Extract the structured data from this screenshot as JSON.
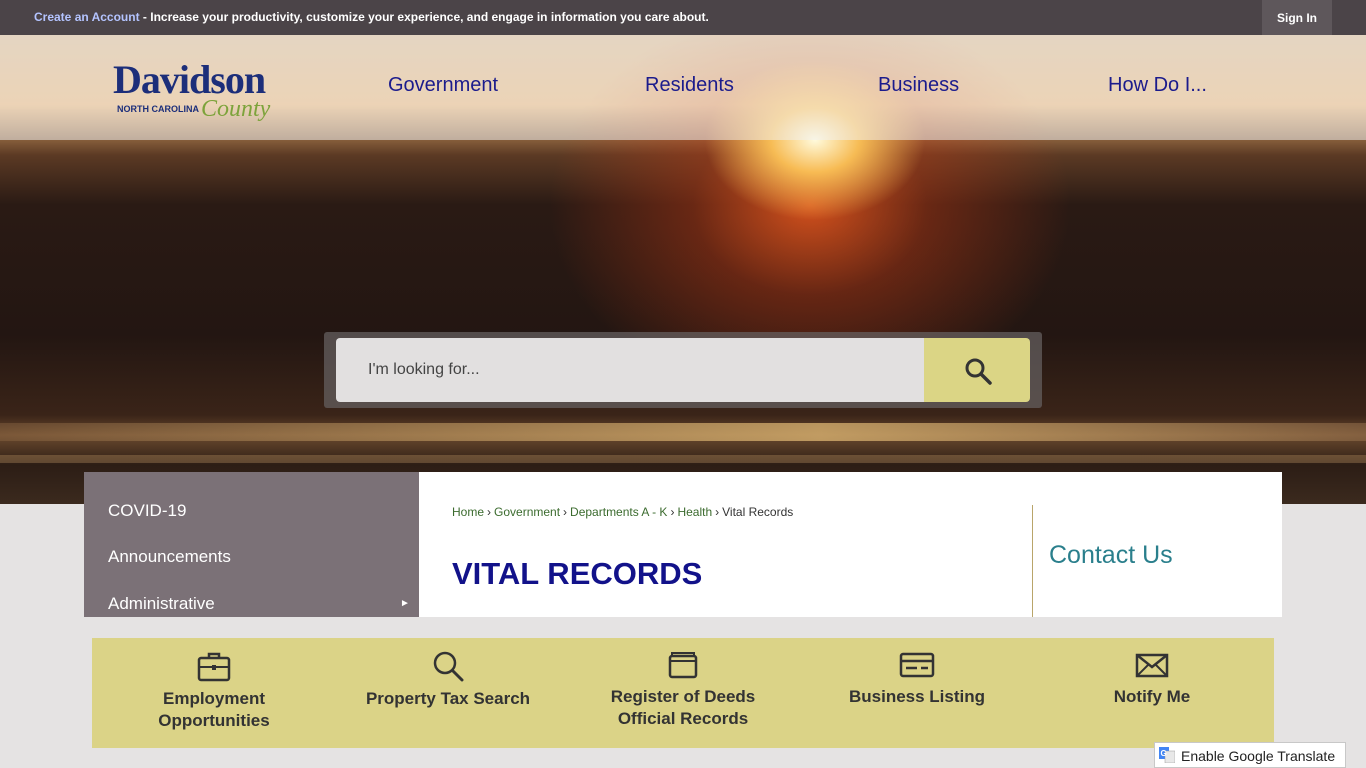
{
  "topbar": {
    "create_account_link": "Create an Account",
    "message": " - Increase your productivity, customize your experience, and engage in information you care about.",
    "sign_in": "Sign In"
  },
  "logo": {
    "word1": "Davidson",
    "word2": "NORTH CAROLINA",
    "word3": "County"
  },
  "nav": [
    "Government",
    "Residents",
    "Business",
    "How Do I..."
  ],
  "search": {
    "placeholder": "I'm looking for...",
    "icon": "search-icon"
  },
  "sidebar": {
    "items": [
      "COVID-19",
      "Announcements",
      "Administrative"
    ]
  },
  "breadcrumb": [
    "Home",
    "Government",
    "Departments A - K",
    "Health",
    "Vital Records"
  ],
  "page_title": "VITAL RECORDS",
  "contact_title": "Contact Us",
  "quicklinks": [
    {
      "line1": "Employment",
      "line2": "Opportunities",
      "icon": "briefcase-icon"
    },
    {
      "line1": "Property Tax Search",
      "line2": "",
      "icon": "search-icon"
    },
    {
      "line1": "Register of Deeds",
      "line2": "Official Records",
      "icon": "folder-icon"
    },
    {
      "line1": "Business Listing",
      "line2": "",
      "icon": "card-icon"
    },
    {
      "line1": "Notify Me",
      "line2": "",
      "icon": "envelope-icon"
    }
  ],
  "translate": {
    "label": "Enable Google Translate"
  },
  "colors": {
    "nav_text": "#1b1b8c",
    "title": "#12128a",
    "quickbar": "#dbd387",
    "sidebar": "#7b7177",
    "contact": "#2a7f8c"
  }
}
